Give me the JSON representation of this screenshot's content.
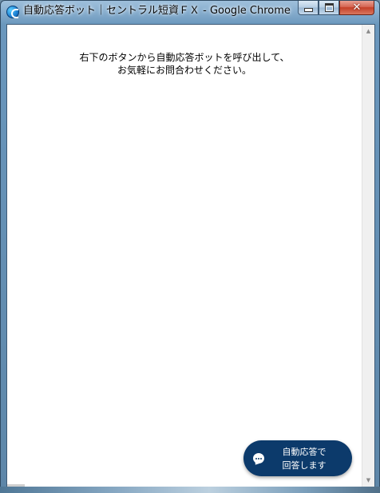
{
  "window": {
    "title": "自動応答ボット｜セントラル短資ＦＸ - Google Chrome",
    "app_icon": "chrome-icon",
    "controls": {
      "minimize": "minimize-icon",
      "maximize": "maximize-icon",
      "close": "✕"
    }
  },
  "page": {
    "message_line1": "右下のボタンから自動応答ボットを呼び出して、",
    "message_line2": "お気軽にお問合わせください。"
  },
  "chat_button": {
    "icon": "chat-bubble-icon",
    "label_line1": "自動応答で",
    "label_line2": "回答します",
    "background": "#0c3a6b"
  },
  "scrollbar": {
    "up_glyph": "▲",
    "down_glyph": "▼"
  }
}
